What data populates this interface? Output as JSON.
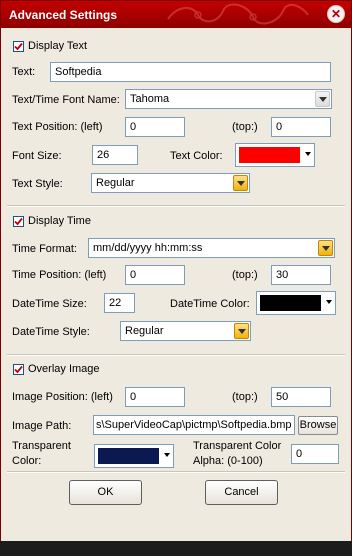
{
  "window": {
    "title": "Advanced Settings",
    "close_glyph": "✕",
    "colors": {
      "titlebar": "#b80000",
      "panel": "#eeeae0"
    }
  },
  "display_text": {
    "checkbox_label": "Display Text",
    "checked": true,
    "text_label": "Text:",
    "text_value": "Softpedia",
    "font_name_label": "Text/Time Font Name:",
    "font_name_value": "Tahoma",
    "position_label": "Text Position: (left)",
    "position_left": "0",
    "top_label": "(top:)",
    "position_top": "0",
    "font_size_label": "Font Size:",
    "font_size_value": "26",
    "text_color_label": "Text Color:",
    "text_color": "#ff0000",
    "style_label": "Text Style:",
    "style_value": "Regular"
  },
  "display_time": {
    "checkbox_label": "Display Time",
    "checked": true,
    "format_label": "Time Format:",
    "format_value": "mm/dd/yyyy hh:mm:ss",
    "position_label": "Time Position: (left)",
    "position_left": "0",
    "top_label": "(top:)",
    "position_top": "30",
    "size_label": "DateTime Size:",
    "size_value": "22",
    "color_label": "DateTime Color:",
    "color": "#000000",
    "style_label": "DateTime Style:",
    "style_value": "Regular"
  },
  "overlay_image": {
    "checkbox_label": "Overlay Image",
    "checked": true,
    "position_label": "Image Position: (left)",
    "position_left": "0",
    "top_label": "(top:)",
    "position_top": "50",
    "path_label": "Image Path:",
    "path_value": "s\\SuperVideoCap\\pictmp\\Softpedia.bmp",
    "browse_label": "Browse",
    "transparent_color_label_1": "Transparent",
    "transparent_color_label_2": "Color:",
    "transparent_color": "#0a1a50",
    "alpha_label_1": "Transparent Color",
    "alpha_label_2": "Alpha: (0-100)",
    "alpha_value": "0"
  },
  "buttons": {
    "ok_label": "OK",
    "cancel_label": "Cancel"
  }
}
